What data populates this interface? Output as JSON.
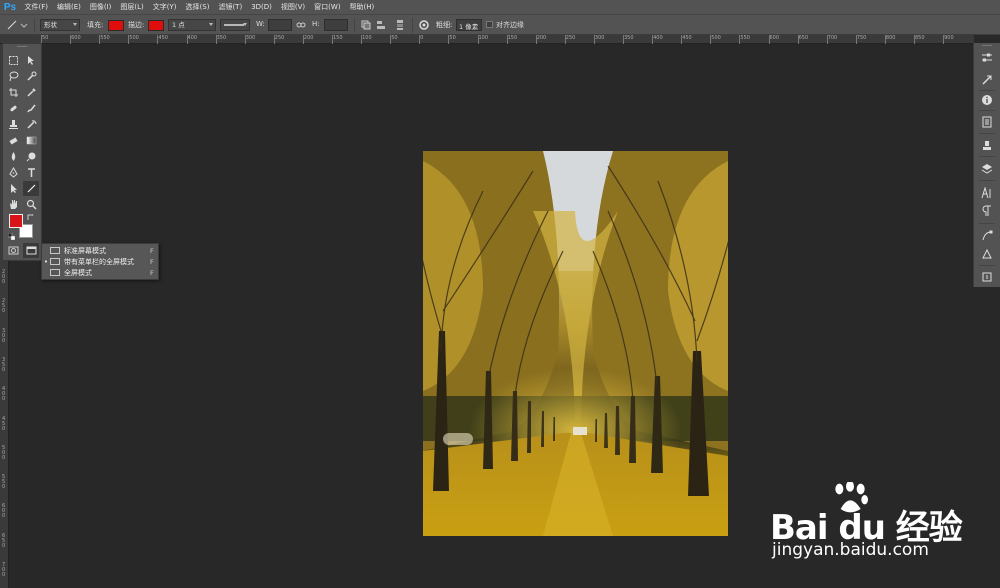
{
  "app": {
    "logo": "Ps"
  },
  "menus": [
    "文件(F)",
    "编辑(E)",
    "图像(I)",
    "图层(L)",
    "文字(Y)",
    "选择(S)",
    "滤镜(T)",
    "3D(D)",
    "视图(V)",
    "窗口(W)",
    "帮助(H)"
  ],
  "options": {
    "mode_value": "形状",
    "fill_label": "填充:",
    "stroke_label": "描边:",
    "stroke_width": "1 点",
    "w_label": "W:",
    "h_label": "H:",
    "weight_label": "粗细:",
    "weight_value": "1 像素",
    "align_edges_label": "对齐边缘",
    "fill_color": "#e00d0d",
    "stroke_color": "#e00d0d"
  },
  "ruler_top": [
    "50",
    "600",
    "550",
    "500",
    "450",
    "400",
    "350",
    "300",
    "250",
    "200",
    "150",
    "100",
    "50",
    "0",
    "50",
    "100",
    "150",
    "200",
    "250",
    "300",
    "350",
    "400",
    "450",
    "500",
    "550",
    "600",
    "650",
    "700",
    "750",
    "800",
    "850",
    "900",
    "950"
  ],
  "ruler_left": [
    "2\n0\n0",
    "2\n5\n0",
    "3\n0\n0",
    "3\n5\n0",
    "4\n0\n0",
    "4\n5\n0",
    "5\n0\n0",
    "5\n5\n0",
    "6\n0\n0",
    "6\n5\n0",
    "7\n0\n0"
  ],
  "colors": {
    "foreground": "#d8141a",
    "background": "#ffffff"
  },
  "screen_mode_menu": {
    "items": [
      {
        "label": "标准屏幕模式",
        "shortcut": "F",
        "selected": false
      },
      {
        "label": "带有菜单栏的全屏模式",
        "shortcut": "F",
        "selected": true
      },
      {
        "label": "全屏模式",
        "shortcut": "F",
        "selected": false
      }
    ],
    "bullet": "•"
  },
  "watermark": {
    "logo": "Bai du 经验",
    "url": "jingyan.baidu.com"
  }
}
